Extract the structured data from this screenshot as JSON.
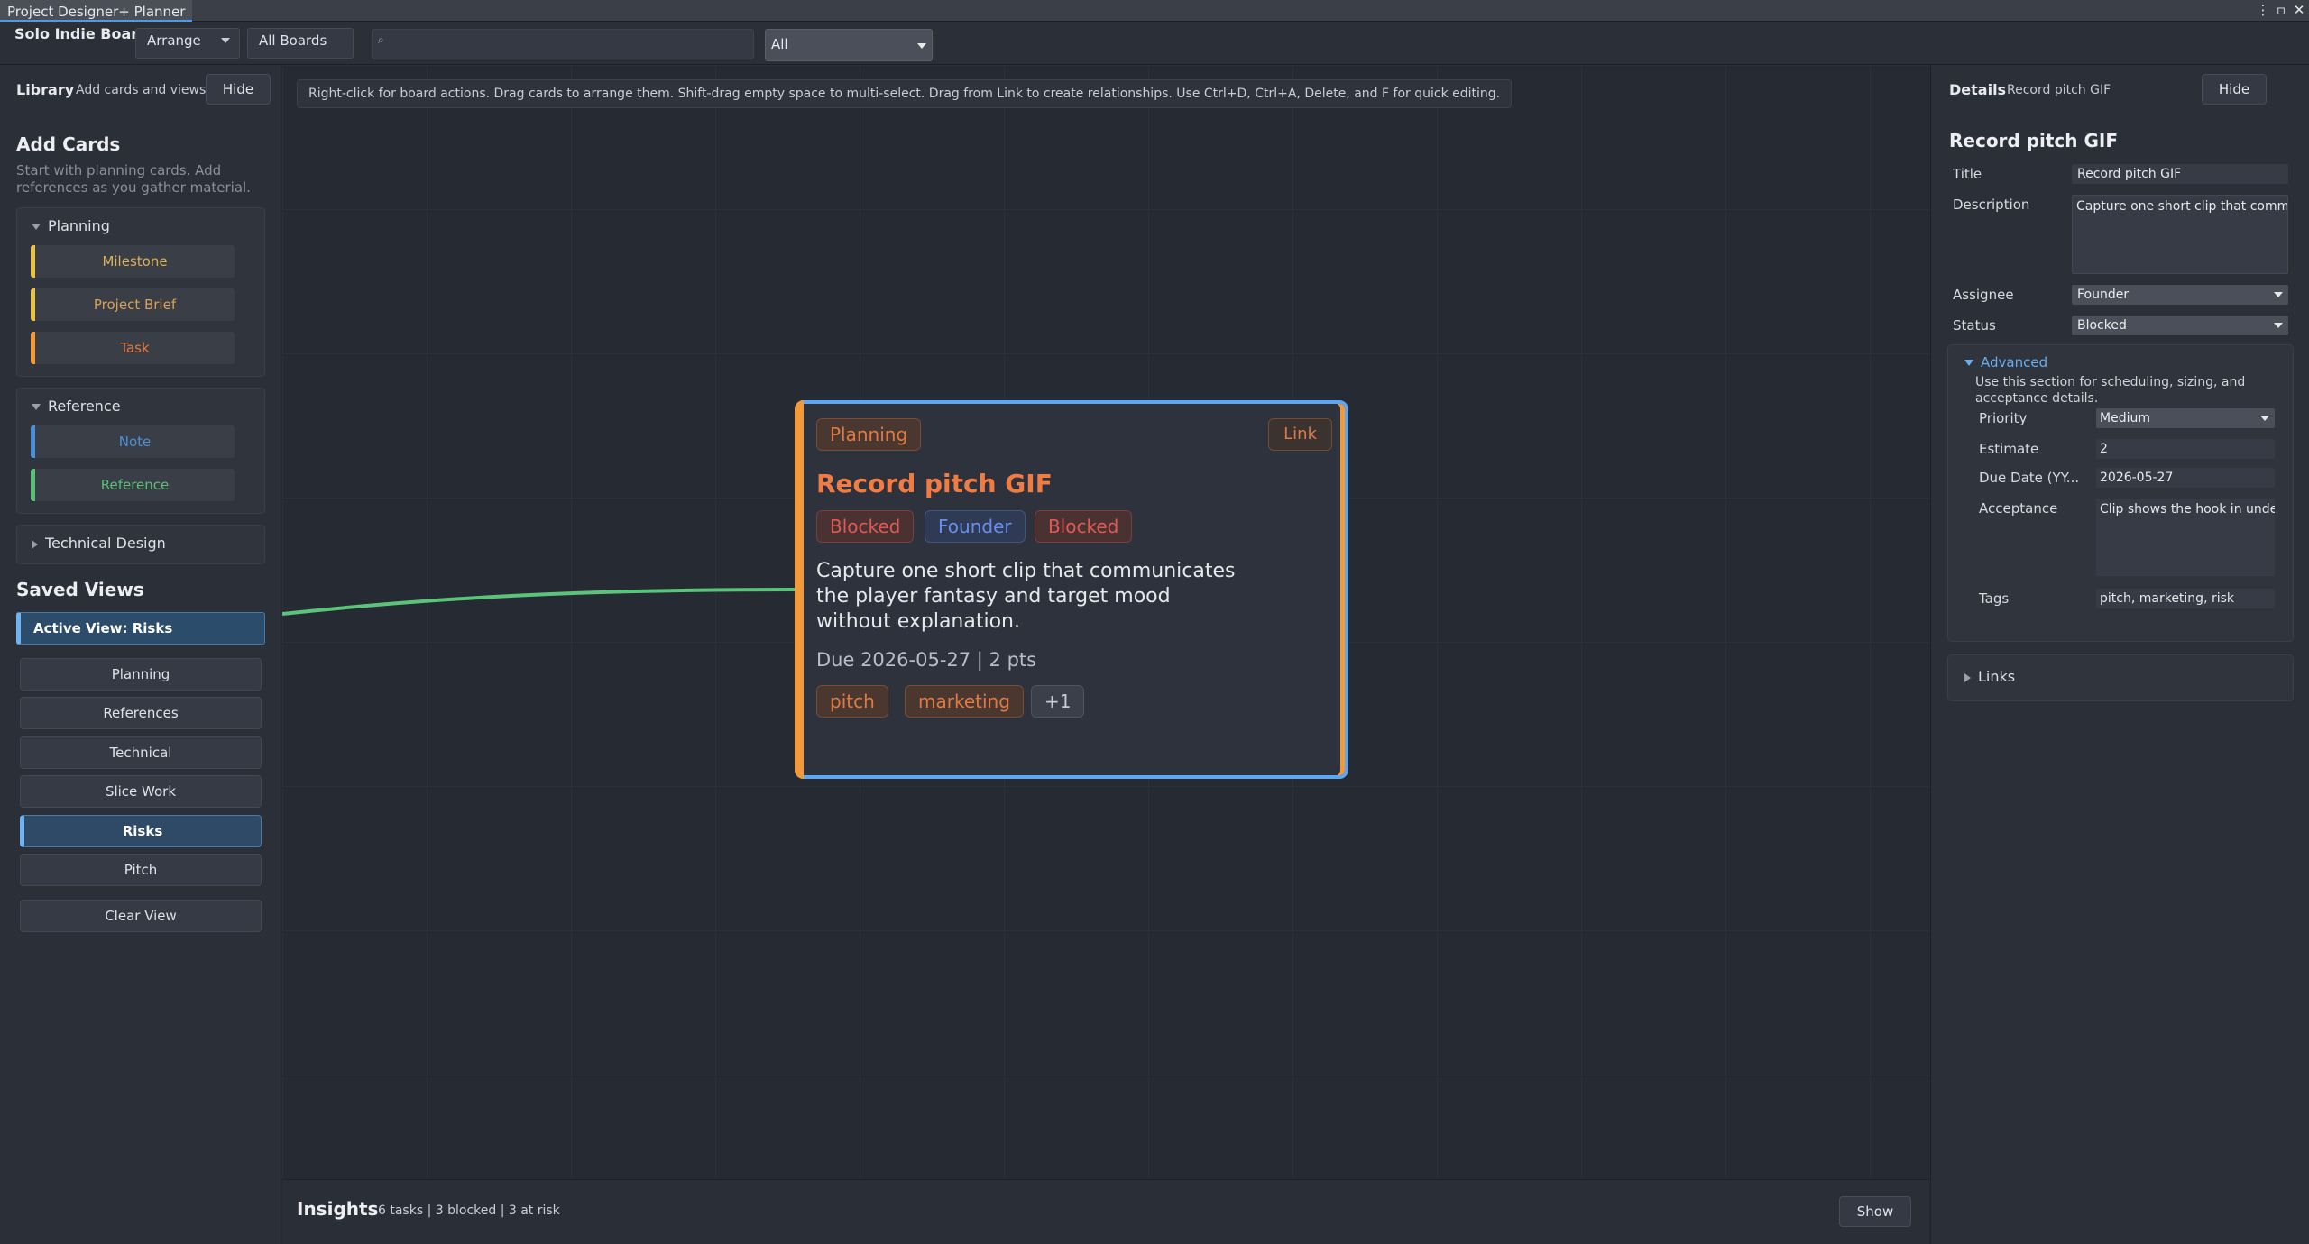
{
  "window": {
    "title": "Project Designer+ Planner"
  },
  "toolbar": {
    "board_name": "Solo Indie Board",
    "arrange_label": "Arrange",
    "boards_value": "All Boards",
    "search_placeholder": "",
    "filter_value": "All"
  },
  "library": {
    "title": "Library",
    "subtitle": "Add cards and views",
    "hide_label": "Hide",
    "add_cards_title": "Add Cards",
    "add_cards_desc": "Start with planning cards. Add references as you gather material.",
    "groups": {
      "planning": {
        "label": "Planning",
        "items": [
          "Milestone",
          "Project Brief",
          "Task"
        ]
      },
      "reference": {
        "label": "Reference",
        "items": [
          "Note",
          "Reference"
        ]
      },
      "technical": {
        "label": "Technical Design"
      }
    },
    "saved_views_title": "Saved Views",
    "active_view": "Active View: Risks",
    "views": [
      "Planning",
      "References",
      "Technical",
      "Slice Work",
      "Risks",
      "Pitch"
    ],
    "clear_view": "Clear View"
  },
  "canvas": {
    "hint": "Right-click for board actions. Drag cards to arrange them. Shift-drag empty space to multi-select. Drag from Link to create relationships. Use Ctrl+D, Ctrl+A, Delete, and F for quick editing.",
    "card": {
      "type_label": "Planning",
      "link_label": "Link",
      "title": "Record pitch GIF",
      "badges": [
        "Blocked",
        "Founder",
        "Blocked"
      ],
      "description": "Capture one short clip that communicates the player fantasy and target mood without explanation.",
      "meta": "Due 2026-05-27 | 2 pts",
      "tags": [
        "pitch",
        "marketing",
        "+1"
      ]
    }
  },
  "insights": {
    "title": "Insights",
    "stats": "6 tasks | 3 blocked | 3 at risk",
    "show_label": "Show"
  },
  "details": {
    "title": "Details",
    "subtitle": "Record pitch GIF",
    "hide_label": "Hide",
    "heading": "Record pitch GIF",
    "fields": {
      "title_label": "Title",
      "title_value": "Record pitch GIF",
      "description_label": "Description",
      "description_value": "Capture one short clip that comm",
      "assignee_label": "Assignee",
      "assignee_value": "Founder",
      "status_label": "Status",
      "status_value": "Blocked"
    },
    "advanced": {
      "label": "Advanced",
      "desc": "Use this section for scheduling, sizing, and acceptance details.",
      "priority_label": "Priority",
      "priority_value": "Medium",
      "estimate_label": "Estimate",
      "estimate_value": "2",
      "due_label": "Due Date (YY...",
      "due_value": "2026-05-27",
      "acceptance_label": "Acceptance",
      "acceptance_value": "Clip shows the hook in unde",
      "tags_label": "Tags",
      "tags_value": "pitch, marketing, risk"
    },
    "links_label": "Links"
  },
  "colors": {
    "accent_blue": "#5fa6f2",
    "task_orange": "#f29a3a",
    "milestone_yellow": "#e9c24a",
    "note_blue": "#4c8fd8",
    "reference_green": "#5bbf7a",
    "blocked_red": "#e05a55",
    "relationship_green": "#5cc47a"
  }
}
